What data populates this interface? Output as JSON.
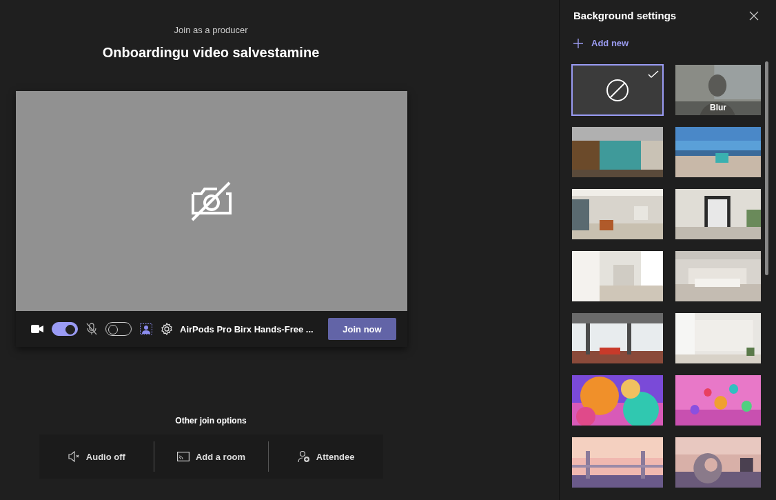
{
  "header": {
    "subtitle": "Join as a producer",
    "title": "Onboardingu video salvestamine"
  },
  "controls": {
    "camera_on": true,
    "mic_on": false,
    "device": "AirPods Pro Birx Hands-Free ...",
    "join": "Join now"
  },
  "other_options": {
    "heading": "Other join options",
    "items": [
      {
        "kind": "audio",
        "label": "Audio off"
      },
      {
        "kind": "room",
        "label": "Add a room"
      },
      {
        "kind": "attendee",
        "label": "Attendee"
      }
    ]
  },
  "panel": {
    "title": "Background settings",
    "add": "Add new",
    "backgrounds": [
      {
        "kind": "none",
        "selected": true
      },
      {
        "kind": "blur",
        "label": "Blur",
        "selected": false
      },
      {
        "kind": "picture",
        "selected": false
      },
      {
        "kind": "picture",
        "selected": false
      },
      {
        "kind": "picture",
        "selected": false
      },
      {
        "kind": "picture",
        "selected": false
      },
      {
        "kind": "picture",
        "selected": false
      },
      {
        "kind": "picture",
        "selected": false
      },
      {
        "kind": "picture",
        "selected": false
      },
      {
        "kind": "picture",
        "selected": false
      },
      {
        "kind": "picture",
        "selected": false
      },
      {
        "kind": "picture",
        "selected": false
      },
      {
        "kind": "picture",
        "selected": false
      },
      {
        "kind": "picture",
        "selected": false
      }
    ]
  }
}
